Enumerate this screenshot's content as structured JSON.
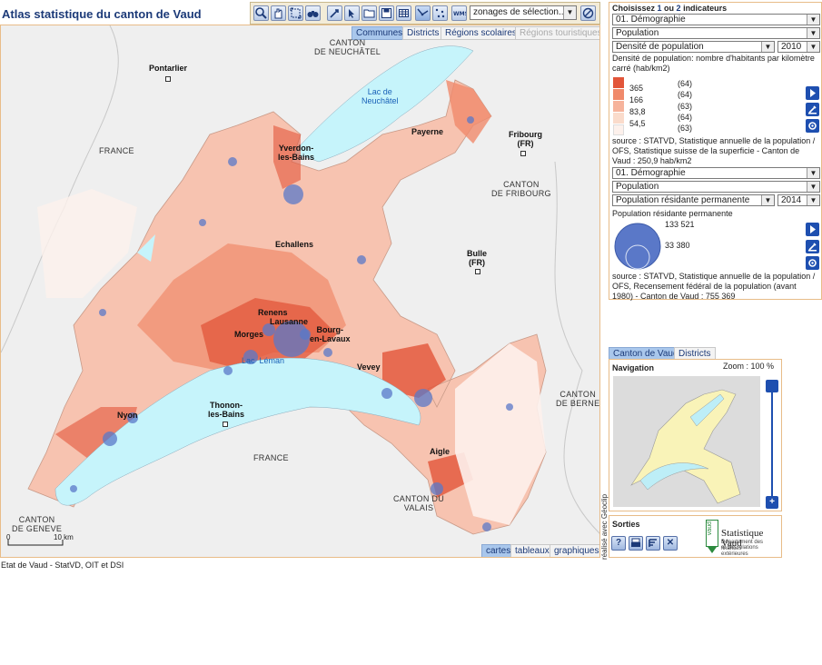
{
  "app": {
    "title": "Atlas statistique du canton de Vaud"
  },
  "toolbar": {
    "tools": [
      "zoom-icon",
      "pan-icon",
      "full-extent-icon",
      "binoculars-icon",
      "select-icon",
      "info-icon",
      "open-icon",
      "save-icon",
      "table-icon",
      "line-select-icon",
      "point-select-icon",
      "wms-icon"
    ],
    "zone_select": "zonages de sélection..."
  },
  "map_tabs": {
    "communes": "Communes",
    "districts": "Districts",
    "regions_scolaires": "Régions scolaires",
    "regions_touristiques": "Régions touristiques"
  },
  "view_tabs": {
    "cartes": "cartes",
    "tableaux": "tableaux",
    "graphiques": "graphiques"
  },
  "map": {
    "places": [
      {
        "name": "Pontarlier"
      },
      {
        "name": "Yverdon-\nles-Bains"
      },
      {
        "name": "Payerne"
      },
      {
        "name": "Fribourg\n(FR)"
      },
      {
        "name": "Echallens"
      },
      {
        "name": "Bulle\n(FR)"
      },
      {
        "name": "Renens"
      },
      {
        "name": "Lausanne"
      },
      {
        "name": "Morges"
      },
      {
        "name": "Bourg-\nen-Lavaux"
      },
      {
        "name": "Vevey"
      },
      {
        "name": "Nyon"
      },
      {
        "name": "Thonon-\nles-Bains"
      },
      {
        "name": "Aigle"
      }
    ],
    "regions": [
      {
        "name": "CANTON\nDE NEUCHÂTEL"
      },
      {
        "name": "FRANCE"
      },
      {
        "name": "CANTON\nDE FRIBOURG"
      },
      {
        "name": "CANTON\nDE BERNE"
      },
      {
        "name": "FRANCE"
      },
      {
        "name": "CANTON DU\nVALAIS"
      },
      {
        "name": "CANTON\nDE GENEVE"
      }
    ],
    "lakes": [
      {
        "name": "Lac de\nNeuchâtel"
      },
      {
        "name": "Lac  Léman"
      }
    ],
    "scale": {
      "start": "0",
      "end": "10 km"
    },
    "colors": {
      "lake": "#c6f4fb",
      "bubble": "#5a78c8",
      "background": "#f0f0f0",
      "class1": "#e2553a",
      "class2": "#f08a6b",
      "class3": "#f6b39c",
      "class4": "#fadbcb",
      "class5": "#fdf1ec"
    }
  },
  "credit": "Etat de Vaud - StatVD, OIT et DSI",
  "realise": "réalisé avec Géoclip",
  "indicators": {
    "heading_prefix": "Choisissez ",
    "heading_num": "1",
    "heading_mid": " ou ",
    "heading_num2": "2",
    "heading_suffix": " indicateurs",
    "ind1": {
      "theme": "01. Démographie",
      "subtheme": "Population",
      "indicator": "Densité de population",
      "year": "2010",
      "title": "Densité de population: nombre d'habitants par kilomètre carré (hab/km2)",
      "legend": [
        {
          "value": "365",
          "count": "(64)",
          "color": "#e2553a"
        },
        {
          "value": "166",
          "count": "(64)",
          "color": "#f08a6b"
        },
        {
          "value": "83,8",
          "count": "(63)",
          "color": "#f6b39c"
        },
        {
          "value": "54,5",
          "count": "(64)",
          "color": "#fadbcb"
        },
        {
          "value": "",
          "count": "(63)",
          "color": "#fdf1ec"
        }
      ],
      "source": "source : STATVD, Statistique annuelle de la population / OFS, Statistique suisse de la superficie - Canton de Vaud : 250,9 hab/km2"
    },
    "ind2": {
      "theme": "01. Démographie",
      "subtheme": "Population",
      "indicator": "Population résidante permanente",
      "year": "2014",
      "title": "Population résidante permanente",
      "legend_large": "133 521",
      "legend_small": "33 380",
      "source": "source : STATVD, Statistique annuelle de la population / OFS, Recensement fédéral de la population (avant 1980) - Canton de Vaud : 755 369"
    }
  },
  "nav": {
    "tab_canton": "Canton de Vaud",
    "tab_districts": "Districts",
    "label": "Navigation",
    "zoom": "Zoom : 100 %"
  },
  "outputs": {
    "label": "Sorties",
    "logo_side": "vaud",
    "logo_title": "Statistique Vaud",
    "logo_sub1": "Département des finances",
    "logo_sub2": "et des relations extérieures"
  }
}
